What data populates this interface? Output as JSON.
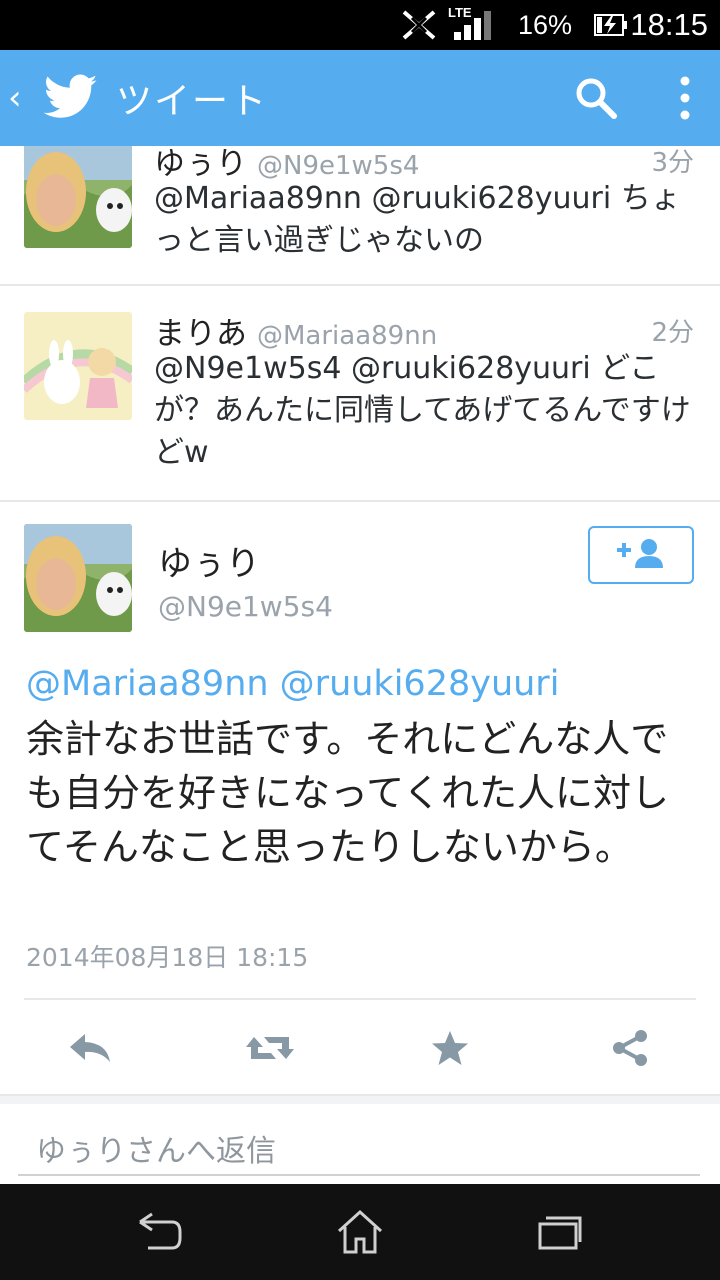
{
  "status_bar": {
    "network": "LTE",
    "battery_percent": "16%",
    "time": "18:15",
    "icons": [
      "nfc-icon",
      "signal-icon",
      "battery-icon"
    ]
  },
  "action_bar": {
    "back_label": "‹",
    "title": "ツイート",
    "icons": [
      "twitter-bird-icon",
      "search-icon",
      "more-vert-icon"
    ]
  },
  "tweets": [
    {
      "name": "ゆぅり",
      "handle": "@N9e1w5s4",
      "time": "3分",
      "text": "@Mariaa89nn @ruuki628yuuri ちょっと言い過ぎじゃないの"
    },
    {
      "name": "まりあ",
      "handle": "@Mariaa89nn",
      "time": "2分",
      "text": "@N9e1w5s4 @ruuki628yuuri どこが？あんたに同情してあげてるんですけどw"
    }
  ],
  "detail": {
    "name": "ゆぅり",
    "handle": "@N9e1w5s4",
    "mentions": "@Mariaa89nn @ruuki628yuuri",
    "text": "余計なお世話です。それにどんな人でも自分を好きになってくれた人に対してそんなこと思ったりしないから。",
    "date": "2014年08月18日 18:15",
    "follow_icon": "add-user-icon",
    "actions": [
      "reply-icon",
      "retweet-icon",
      "favorite-star-icon",
      "share-icon"
    ]
  },
  "reply": {
    "placeholder": "ゆぅりさんへ返信"
  },
  "colors": {
    "accent": "#55acee",
    "muted_text": "#9aa3ab",
    "status_bar": "#000000",
    "nav_bar": "#111111"
  }
}
